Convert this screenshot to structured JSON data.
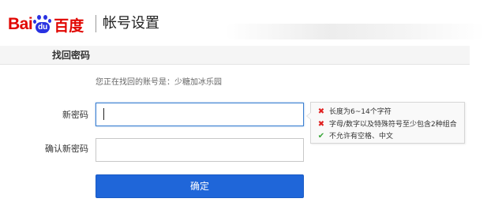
{
  "header": {
    "logo": {
      "part1": "Bai",
      "paw": "du",
      "part2": "百度"
    },
    "title": "帐号设置"
  },
  "subnav": {
    "title": "找回密码"
  },
  "form": {
    "account_info": "您正在找回的账号是：少糖加冰乐园",
    "new_password_label": "新密码",
    "new_password_value": "",
    "confirm_password_label": "确认新密码",
    "confirm_password_value": "",
    "submit_label": "确定"
  },
  "password_rules": [
    {
      "status": "fail",
      "icon": "cross-icon",
      "text": "长度为6~14个字符"
    },
    {
      "status": "fail",
      "icon": "cross-icon",
      "text": "字母/数字以及特殊符号至少包含2种组合"
    },
    {
      "status": "pass",
      "icon": "check-icon",
      "text": "不允许有空格、中文"
    }
  ],
  "colors": {
    "brand_red": "#e10601",
    "brand_blue": "#2932e1",
    "button_blue": "#1f66d9",
    "rule_fail": "#e02020",
    "rule_pass": "#3aa63a"
  }
}
